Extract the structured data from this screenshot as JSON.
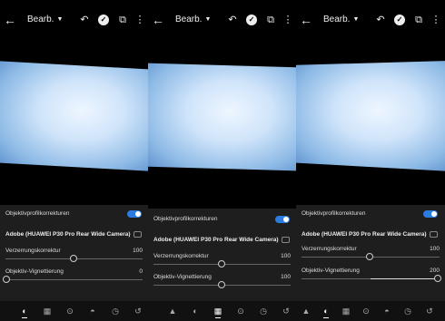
{
  "panels": [
    {
      "title": "Bearb.",
      "section_label": "Objektivprofilkorrekturen",
      "toggle_on": true,
      "profile": "Adobe (HUAWEI P30 Pro Rear Wide Camera)",
      "sliders": [
        {
          "label": "Verzerrungskorrektur",
          "value": "100",
          "level": 0.5
        },
        {
          "label": "Objektiv-Vignettierung",
          "value": "0",
          "level": 0.0
        }
      ]
    },
    {
      "title": "Bearb.",
      "section_label": "Objektivprofilkorrekturen",
      "toggle_on": true,
      "profile": "Adobe (HUAWEI P30 Pro Rear Wide Camera)",
      "sliders": [
        {
          "label": "Verzerrungskorrektur",
          "value": "100",
          "level": 0.5
        },
        {
          "label": "Objektiv-Vignettierung",
          "value": "100",
          "level": 0.5
        }
      ]
    },
    {
      "title": "Bearb.",
      "section_label": "Objektivprofilkorrekturen",
      "toggle_on": true,
      "profile": "Adobe (HUAWEI P30 Pro Rear Wide Camera)",
      "sliders": [
        {
          "label": "Verzerrungskorrektur",
          "value": "100",
          "level": 0.5
        },
        {
          "label": "Objektiv-Vignettierung",
          "value": "200",
          "level": 1.0
        }
      ]
    }
  ],
  "icons": {
    "back": "back-arrow-icon",
    "undo": "undo-icon",
    "confirm": "check-circle-icon",
    "share": "share-icon",
    "more": "more-vertical-icon",
    "tabs": [
      "lens-correction-icon",
      "effects-icon",
      "geometry-icon",
      "optics-icon",
      "detail-icon",
      "history-icon",
      "reset-icon"
    ]
  },
  "colors": {
    "accent": "#2b7be0",
    "panel_bg": "#1e1e1e"
  }
}
